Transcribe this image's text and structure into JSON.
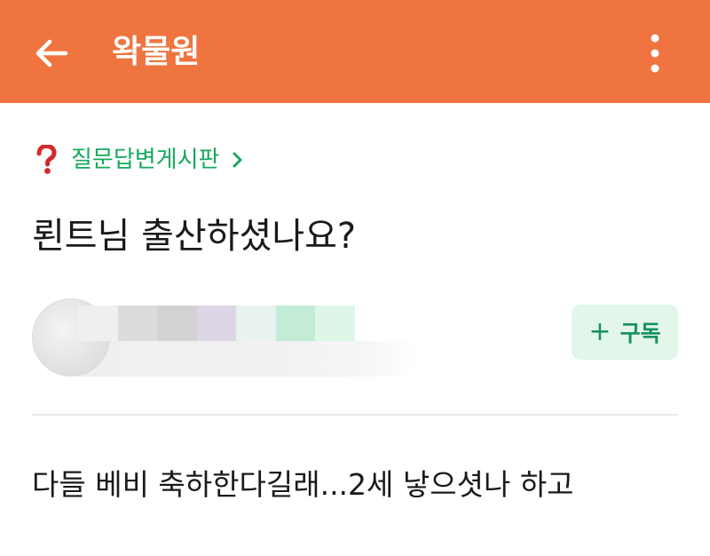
{
  "appbar": {
    "title": "왁물원",
    "back_icon": "arrow-left-icon",
    "more_icon": "more-vert-icon",
    "background_color": "#ef7440"
  },
  "board": {
    "icon": "question-mark-icon",
    "label": "질문답변게시판",
    "chevron_icon": "chevron-right-icon",
    "accent_color": "#17a85c"
  },
  "post": {
    "title": "뢴트님 출산하셨나요?",
    "body": "다들 베비 축하한다길래...2세 낳으셧나 하고"
  },
  "author": {
    "avatar": "avatar-blurred",
    "subscribe_plus": "+",
    "subscribe_label": "구독"
  }
}
